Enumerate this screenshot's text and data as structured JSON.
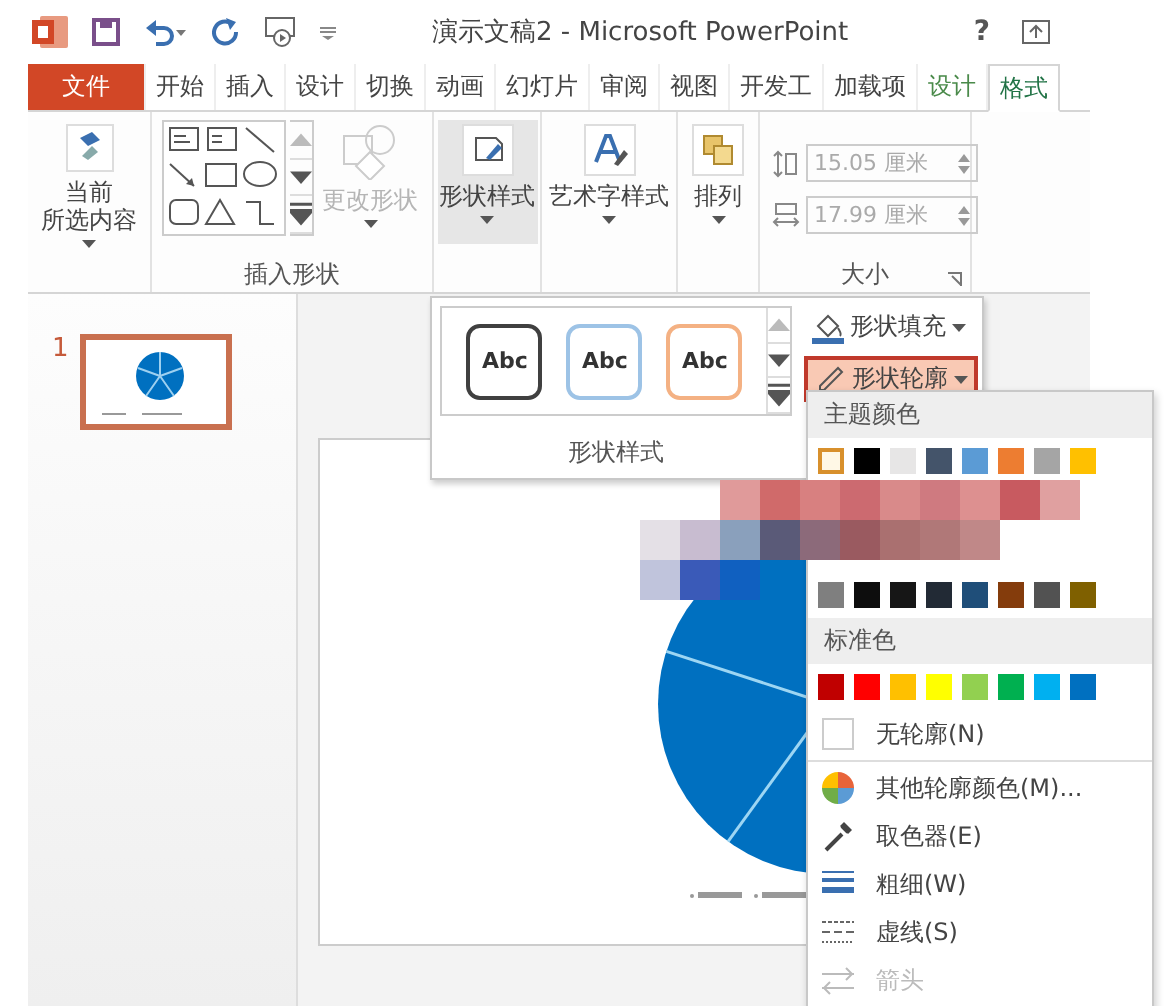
{
  "title_bar": {
    "title": "演示文稿2 - Microsoft PowerPoint",
    "help": "?"
  },
  "tabs": [
    {
      "label": "文件",
      "kind": "file",
      "selected": false
    },
    {
      "label": "开始",
      "kind": "tab",
      "selected": false
    },
    {
      "label": "插入",
      "kind": "tab",
      "selected": false
    },
    {
      "label": "设计",
      "kind": "tab",
      "selected": false
    },
    {
      "label": "切换",
      "kind": "tab",
      "selected": false
    },
    {
      "label": "动画",
      "kind": "tab",
      "selected": false
    },
    {
      "label": "幻灯片",
      "kind": "tab",
      "selected": false
    },
    {
      "label": "审阅",
      "kind": "tab",
      "selected": false
    },
    {
      "label": "视图",
      "kind": "tab",
      "selected": false
    },
    {
      "label": "开发工",
      "kind": "tab",
      "selected": false
    },
    {
      "label": "加载项",
      "kind": "tab",
      "selected": false
    },
    {
      "label": "设计",
      "kind": "context",
      "selected": false
    },
    {
      "label": "格式",
      "kind": "context",
      "selected": true
    }
  ],
  "ribbon": {
    "current_selection": {
      "lines": [
        "当前",
        "所选内容"
      ]
    },
    "insert_shapes": {
      "change_shape": {
        "label": "更改形状",
        "disabled": true
      },
      "label": "插入形状"
    },
    "shape_styles": {
      "label": "形状样式",
      "active": true
    },
    "wordart_styles": {
      "label": "艺术字样式"
    },
    "arrange": {
      "label": "排列"
    },
    "size": {
      "height": "15.05 厘米",
      "width": "17.99 厘米",
      "disabled": true,
      "label": "大小"
    }
  },
  "slides": [
    {
      "number": "1",
      "selected": true
    }
  ],
  "style_gallery": {
    "styles": [
      {
        "label": "Abc",
        "color": "#404040"
      },
      {
        "label": "Abc",
        "color": "#9dc3e6"
      },
      {
        "label": "Abc",
        "color": "#f4b183"
      }
    ],
    "label": "形状样式",
    "fill_button": "形状填充",
    "outline_button": {
      "label": "形状轮廓",
      "open": true
    }
  },
  "outline_menu": {
    "theme_header": "主题颜色",
    "theme_colors": [
      {
        "color": "#fff8e6",
        "selected": true
      },
      {
        "color": "#000000",
        "selected": false
      },
      {
        "color": "#e7e6e6",
        "selected": false
      },
      {
        "color": "#44546a",
        "selected": false
      },
      {
        "color": "#5b9bd5",
        "selected": false
      },
      {
        "color": "#ed7d31",
        "selected": false
      },
      {
        "color": "#a5a5a5",
        "selected": false
      },
      {
        "color": "#ffc000",
        "selected": false
      }
    ],
    "shade_colors": [
      {
        "color": "#7f7f7f"
      },
      {
        "color": "#0d0d0d"
      },
      {
        "color": "#161616"
      },
      {
        "color": "#222a35"
      },
      {
        "color": "#1f4e79"
      },
      {
        "color": "#843c0c"
      },
      {
        "color": "#525252"
      },
      {
        "color": "#7f6000"
      }
    ],
    "standard_header": "标准色",
    "standard_colors": [
      {
        "color": "#c00000"
      },
      {
        "color": "#ff0000"
      },
      {
        "color": "#ffc000"
      },
      {
        "color": "#ffff00"
      },
      {
        "color": "#92d050"
      },
      {
        "color": "#00b050"
      },
      {
        "color": "#00b0f0"
      },
      {
        "color": "#0070c0"
      }
    ],
    "items": [
      {
        "label": "无轮廓(N)",
        "kind": "none",
        "disabled": false
      },
      {
        "label": "其他轮廓颜色(M)...",
        "kind": "more",
        "disabled": false
      },
      {
        "label": "取色器(E)",
        "kind": "eyedropper",
        "disabled": false
      },
      {
        "label": "粗细(W)",
        "kind": "weight",
        "disabled": false
      },
      {
        "label": "虚线(S)",
        "kind": "dashes",
        "disabled": false
      },
      {
        "label": "箭头",
        "kind": "arrows",
        "disabled": true
      }
    ]
  }
}
